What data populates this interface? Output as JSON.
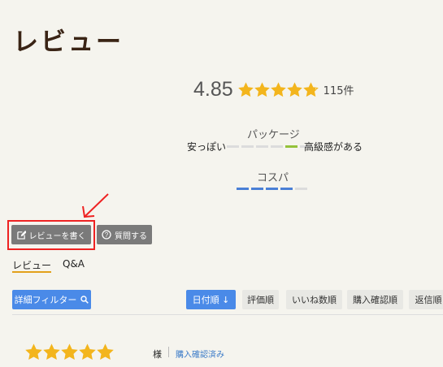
{
  "page": {
    "title": "レビュー"
  },
  "rating": {
    "score": "4.85",
    "count": "115件",
    "stars_value": 4.85,
    "star_color": "#f3b51d"
  },
  "attributes": [
    {
      "name": "パッケージ",
      "low": "安っぽい",
      "high": "高級感がある",
      "level": 4,
      "segments": 6,
      "color": "#94c23a"
    },
    {
      "name": "コスパ",
      "low": "",
      "high": "",
      "level": 4,
      "segments": 5,
      "color": "#4a7fd6"
    }
  ],
  "actions": {
    "write_review": "レビューを書く",
    "ask_question": "質問する",
    "write_icon": "edit-icon",
    "ask_icon": "question-circle-icon"
  },
  "tabs": {
    "reviews": "レビュー",
    "qa": "Q&A",
    "active_color": "#e2a11c"
  },
  "filter": {
    "label": "詳細フィルター",
    "icon": "search-icon",
    "color": "#4a8ae8"
  },
  "sort": {
    "date": "日付順 ↓",
    "rating": "評価順",
    "likes": "いいね数順",
    "verified": "購入確認順",
    "replies": "返信順"
  },
  "review": {
    "stars_value": 5,
    "honorific": "様",
    "verified_label": "購入確認済み"
  },
  "annotation": {
    "highlight_color": "#e22222"
  }
}
